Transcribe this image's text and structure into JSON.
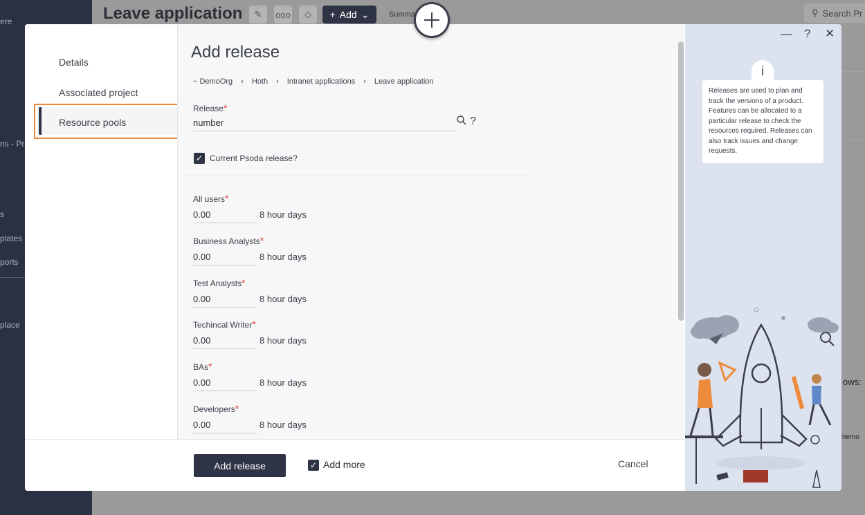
{
  "background": {
    "sidebar_items": [
      "ere",
      "ns - Pro",
      "s",
      "plates",
      "ports",
      "place"
    ],
    "page_title": "Leave application",
    "add_label": "Add",
    "summary_label": "Summar",
    "search_placeholder": "Search Pr",
    "rows_label": "ows:",
    "memo_label": "memo"
  },
  "modal": {
    "nav": {
      "items": [
        "Details",
        "Associated project",
        "Resource pools"
      ],
      "active": "Resource pools"
    },
    "title": "Add release",
    "breadcrumb": [
      "~ DemoOrg",
      "Hoth",
      "Intranet applications",
      "Leave application"
    ],
    "release_label": "Release",
    "release_value": "number",
    "help_symbol": "?",
    "current_release_label": "Current Psoda release?",
    "current_release_checked": true,
    "required_marker": "*",
    "pools": [
      {
        "label": "All users",
        "value": "0.00",
        "unit": "8 hour days"
      },
      {
        "label": "Business Analysts",
        "value": "0.00",
        "unit": "8 hour days"
      },
      {
        "label": "Test Analysts",
        "value": "0.00",
        "unit": "8 hour days"
      },
      {
        "label": "Techincal Writer",
        "value": "0.00",
        "unit": "8 hour days"
      },
      {
        "label": "BAs",
        "value": "0.00",
        "unit": "8 hour days"
      },
      {
        "label": "Developers",
        "value": "0.00",
        "unit": "8 hour days"
      }
    ],
    "info_icon": "i",
    "info_text": "Releases are used to plan and track the versions of a product. Features can be allocated to a particular release to check the resources required. Releases can also track issues and change requests.",
    "window_controls": {
      "minimize": "—",
      "help": "?",
      "close": "✕"
    },
    "footer": {
      "add_button": "Add release",
      "add_more_label": "Add more",
      "add_more_checked": true,
      "cancel": "Cancel"
    }
  },
  "colors": {
    "primary": "#2e3345",
    "highlight": "#ee8a3c",
    "required": "#e03b3b",
    "right_panel": "#dde3ee"
  }
}
